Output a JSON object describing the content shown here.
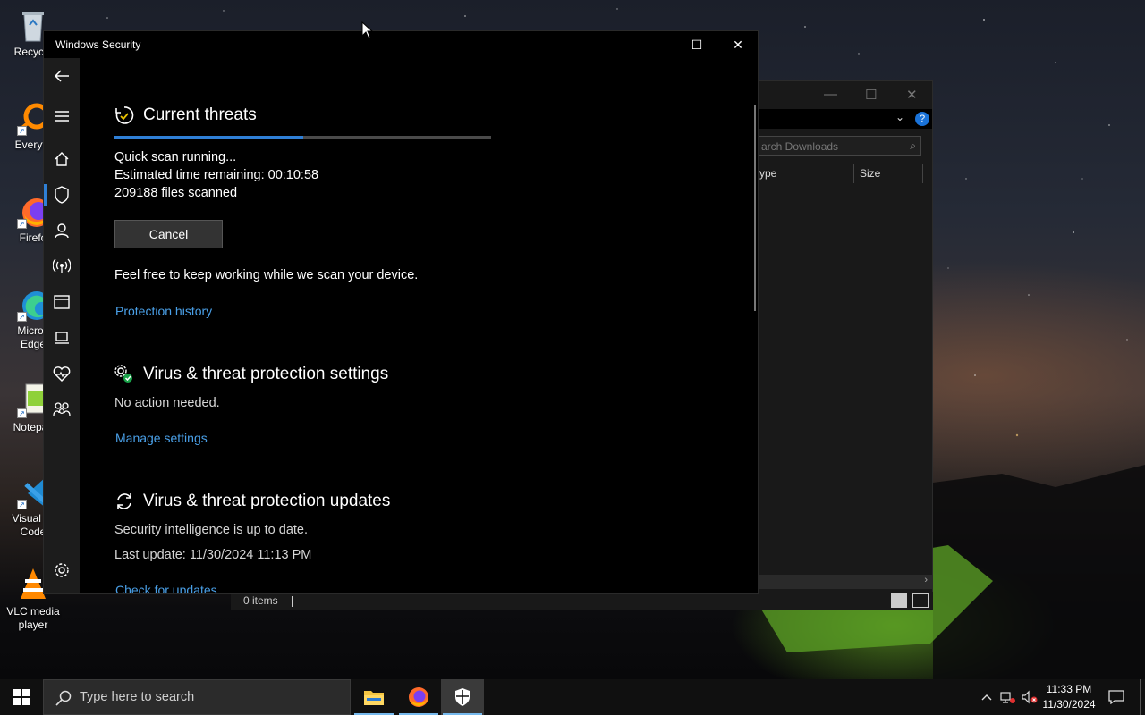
{
  "desktop": {
    "icons": [
      {
        "label": "Recycle",
        "icon": "recycle-bin-icon"
      },
      {
        "label": "Everyth",
        "icon": "everything-search-icon"
      },
      {
        "label": "Firefo",
        "icon": "firefox-icon"
      },
      {
        "label": "Micros\nEdge",
        "label_line1": "Micros",
        "label_line2": "Edge",
        "icon": "edge-icon"
      },
      {
        "label": "Notepac",
        "icon": "notepad-plus-plus-icon"
      },
      {
        "label": "Visual St\nCode",
        "label_line1": "Visual St",
        "label_line2": "Code",
        "icon": "vscode-icon"
      },
      {
        "label": "VLC media\nplayer",
        "label_line1": "VLC media",
        "label_line2": "player",
        "icon": "vlc-icon"
      }
    ]
  },
  "explorer": {
    "search_placeholder": "arch Downloads",
    "col_type": "ype",
    "col_size": "Size",
    "status_items": "0 items",
    "help_badge": "?"
  },
  "window": {
    "title": "Windows Security",
    "controls": {
      "minimize": "—",
      "maximize": "☐",
      "close": "✕"
    }
  },
  "nav_rail": {
    "items": [
      "back-arrow-icon",
      "hamburger-menu-icon",
      "home-icon",
      "shield-icon",
      "account-icon",
      "firewall-network-icon",
      "app-browser-control-icon",
      "device-security-icon",
      "device-health-heart-icon",
      "family-options-icon"
    ],
    "settings": "gear-icon"
  },
  "current_threats": {
    "heading": "Current threats",
    "progress": 0.5,
    "status": "Quick scan running...",
    "eta": "Estimated time remaining:  00:10:58",
    "files": "209188  files scanned",
    "cancel": "Cancel",
    "note": "Feel free to keep working while we scan your device.",
    "history_link": "Protection history"
  },
  "settings_section": {
    "heading": "Virus & threat protection settings",
    "status": "No action needed.",
    "link": "Manage settings"
  },
  "updates_section": {
    "heading": "Virus & threat protection updates",
    "status": "Security intelligence is up to date.",
    "last_update": "Last update: 11/30/2024 11:13 PM",
    "link": "Check for updates"
  },
  "taskbar": {
    "search_placeholder": "Type here to search",
    "apps": [
      "file-explorer-icon",
      "firefox-icon",
      "windows-security-icon"
    ],
    "time": "11:33 PM",
    "date": "11/30/2024"
  },
  "colors": {
    "accent": "#2f7fd6",
    "link": "#4aa0e8",
    "window_bg": "#000000",
    "rail_bg": "#1c1c1c"
  }
}
